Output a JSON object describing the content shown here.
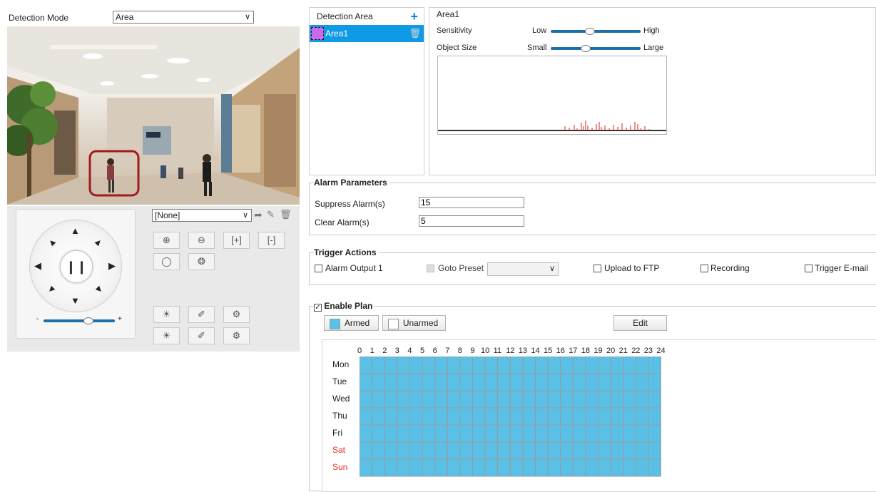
{
  "detection": {
    "mode_label": "Detection Mode",
    "mode_value": "Area"
  },
  "ptz": {
    "preset_value": "[None]"
  },
  "area_list": {
    "header": "Detection Area",
    "items": [
      {
        "name": "Area1",
        "color": "#c86be8"
      }
    ]
  },
  "area_params": {
    "title": "Area1",
    "sensitivity": {
      "label": "Sensitivity",
      "low": "Low",
      "high": "High",
      "level": 0.45
    },
    "object_size": {
      "label": "Object Size",
      "low": "Small",
      "high": "Large",
      "level": 0.4
    }
  },
  "alarm": {
    "legend": "Alarm Parameters",
    "suppress_label": "Suppress Alarm(s)",
    "suppress_value": "15",
    "clear_label": "Clear Alarm(s)",
    "clear_value": "5"
  },
  "trigger": {
    "legend": "Trigger Actions",
    "alarm_output": "Alarm Output 1",
    "goto_preset": "Goto Preset",
    "upload_ftp": "Upload to FTP",
    "recording": "Recording",
    "email": "Trigger E-mail"
  },
  "plan": {
    "legend": "Enable Plan",
    "armed": "Armed",
    "unarmed": "Unarmed",
    "edit": "Edit",
    "hours": [
      "0",
      "1",
      "2",
      "3",
      "4",
      "5",
      "6",
      "7",
      "8",
      "9",
      "10",
      "11",
      "12",
      "13",
      "14",
      "15",
      "16",
      "17",
      "18",
      "19",
      "20",
      "21",
      "22",
      "23",
      "24"
    ],
    "days": [
      "Mon",
      "Tue",
      "Wed",
      "Thu",
      "Fri",
      "Sat",
      "Sun"
    ],
    "armed_color": "#5bc0e6",
    "weekend_color": "#e8322d"
  }
}
